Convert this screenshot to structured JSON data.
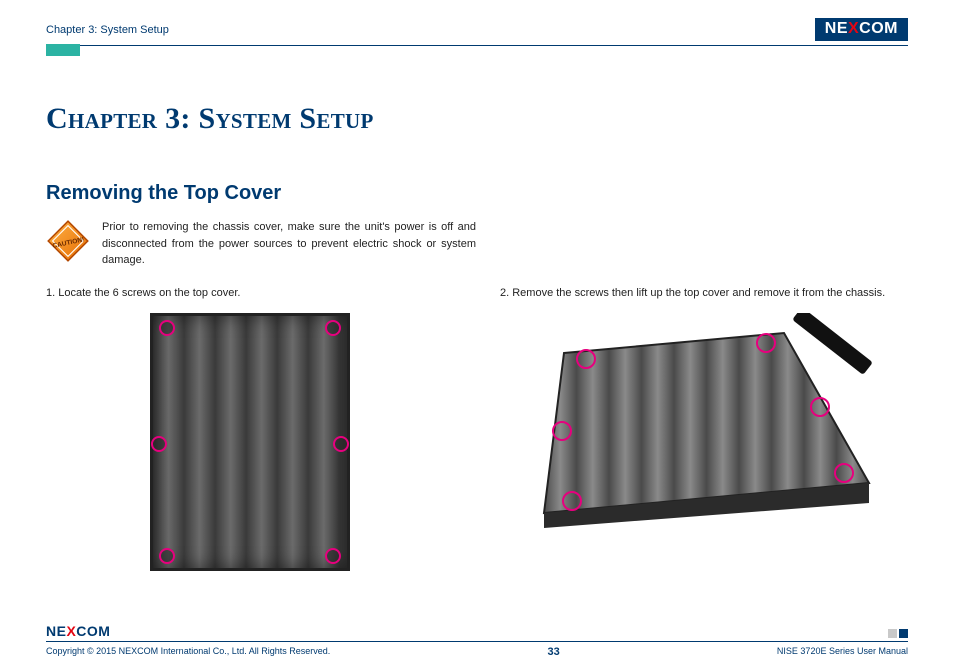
{
  "header": {
    "breadcrumb": "Chapter 3: System Setup",
    "brand_pre": "NE",
    "brand_x": "X",
    "brand_post": "COM"
  },
  "chapter_title": "Chapter 3: System Setup",
  "section_title": "Removing the Top Cover",
  "caution": {
    "label": "CAUTION!",
    "text": "Prior to removing the chassis cover, make sure the unit's power is off and disconnected from the power sources to prevent electric shock or system damage."
  },
  "steps": {
    "s1": "1. Locate the 6 screws on the top cover.",
    "s2": "2. Remove the screws then lift up the top cover and remove it from the chassis."
  },
  "footer": {
    "brand_pre": "NE",
    "brand_x": "X",
    "brand_post": "COM",
    "copyright": "Copyright © 2015 NEXCOM International Co., Ltd. All Rights Reserved.",
    "page": "33",
    "doc": "NISE 3720E Series User Manual"
  }
}
